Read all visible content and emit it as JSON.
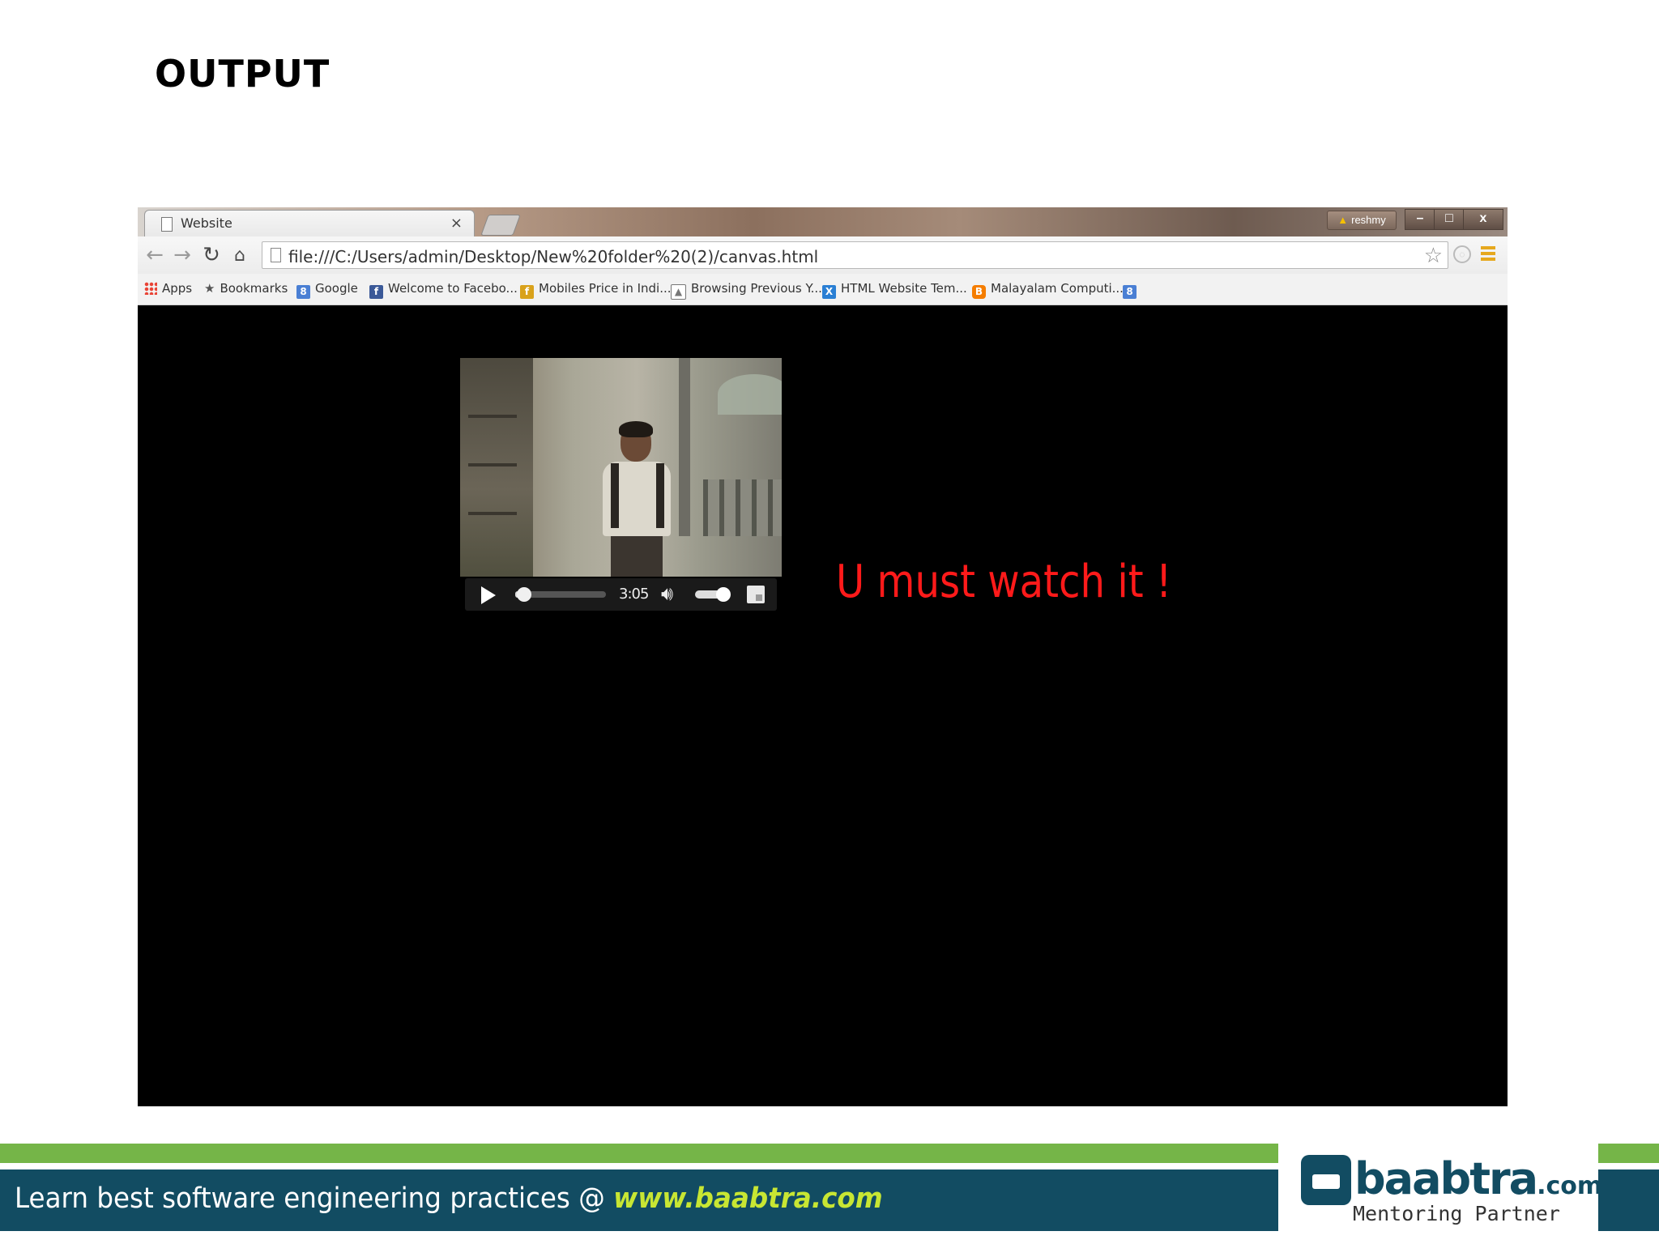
{
  "slide": {
    "title": "OUTPUT"
  },
  "browser": {
    "tab_title": "Website",
    "tab_close": "×",
    "user_label": "reshmy",
    "window_buttons": {
      "minimize": "–",
      "restore": "□",
      "close": "x"
    },
    "url": "file:///C:/Users/admin/Desktop/New%20folder%20(2)/canvas.html",
    "bookmarks": [
      {
        "label": "Apps",
        "icon": "apps-grid-icon"
      },
      {
        "label": "Bookmarks",
        "icon": "star-icon"
      },
      {
        "label": "Google",
        "icon": "google-plus-icon",
        "color": "#4a7fd4"
      },
      {
        "label": "Welcome to Facebo...",
        "icon": "facebook-icon",
        "color": "#3b5998"
      },
      {
        "label": "Mobiles Price in Indi...",
        "icon": "mobiles-icon",
        "color": "#d9a21b"
      },
      {
        "label": "Browsing Previous Y...",
        "icon": "image-icon",
        "color": "#777777"
      },
      {
        "label": "HTML Website Tem...",
        "icon": "html-template-icon",
        "color": "#2a7fd4"
      },
      {
        "label": "Malayalam Computi...",
        "icon": "blogger-icon",
        "color": "#f57d00"
      },
      {
        "label": "",
        "icon": "google-plus-icon",
        "color": "#4a7fd4"
      }
    ]
  },
  "video": {
    "time": "3:05",
    "progress_fraction": 0.05,
    "volume_fraction": 1.0
  },
  "page": {
    "tagline": "U must watch it !",
    "tagline_color": "#ff1a1a"
  },
  "footer": {
    "text": "Learn best software engineering practices @ ",
    "url": "www.baabtra.com",
    "logo_name": "baabtra",
    "logo_suffix": ".com",
    "logo_sub": "Mentoring Partner",
    "colors": {
      "band": "#124c62",
      "green": "#75b548",
      "url": "#c8e633"
    }
  }
}
